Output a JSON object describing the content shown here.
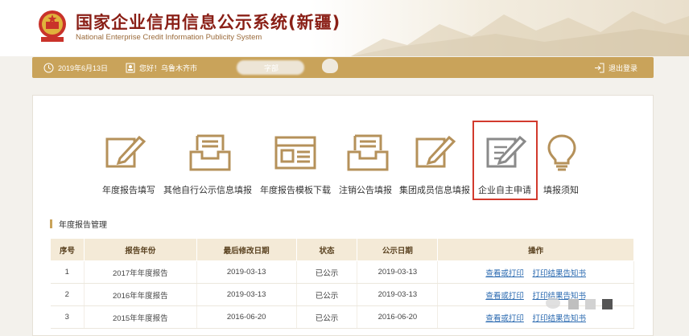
{
  "header": {
    "title": "国家企业信用信息公示系统(新疆)",
    "subtitle": "National Enterprise Credit Information Publicity System"
  },
  "statusbar": {
    "date": "2019年6月13日",
    "greeting": "您好！乌鲁木齐市",
    "greeting_suffix": "字部",
    "logout": "退出登录"
  },
  "functions": [
    {
      "label": "年度报告填写",
      "icon": "edit-icon"
    },
    {
      "label": "其他自行公示信息填报",
      "icon": "inbox-icon"
    },
    {
      "label": "年度报告模板下载",
      "icon": "template-icon"
    },
    {
      "label": "注销公告填报",
      "icon": "inbox-icon"
    },
    {
      "label": "集团成员信息填报",
      "icon": "edit-icon"
    },
    {
      "label": "企业自主申请",
      "icon": "edit-icon"
    },
    {
      "label": "填报须知",
      "icon": "lightbulb-icon"
    }
  ],
  "section": {
    "title": "年度报告管理"
  },
  "table": {
    "headers": [
      "序号",
      "报告年份",
      "最后修改日期",
      "状态",
      "公示日期",
      "操作"
    ],
    "rows": [
      {
        "no": "1",
        "year": "2017年年度报告",
        "modified": "2019-03-13",
        "status": "已公示",
        "published": "2019-03-13",
        "op1": "查看或打印",
        "op2": "打印结果告知书"
      },
      {
        "no": "2",
        "year": "2016年年度报告",
        "modified": "2019-03-13",
        "status": "已公示",
        "published": "2019-03-13",
        "op1": "查看或打印",
        "op2": "打印结果告知书"
      },
      {
        "no": "3",
        "year": "2015年年度报告",
        "modified": "2016-06-20",
        "status": "已公示",
        "published": "2016-06-20",
        "op1": "查看或打印",
        "op2": "打印结果告知书"
      }
    ]
  },
  "colors": {
    "gold": "#c9a35a",
    "title_red": "#8a1f16",
    "link_blue": "#2b6ab0",
    "highlight_red": "#d23a2d"
  }
}
